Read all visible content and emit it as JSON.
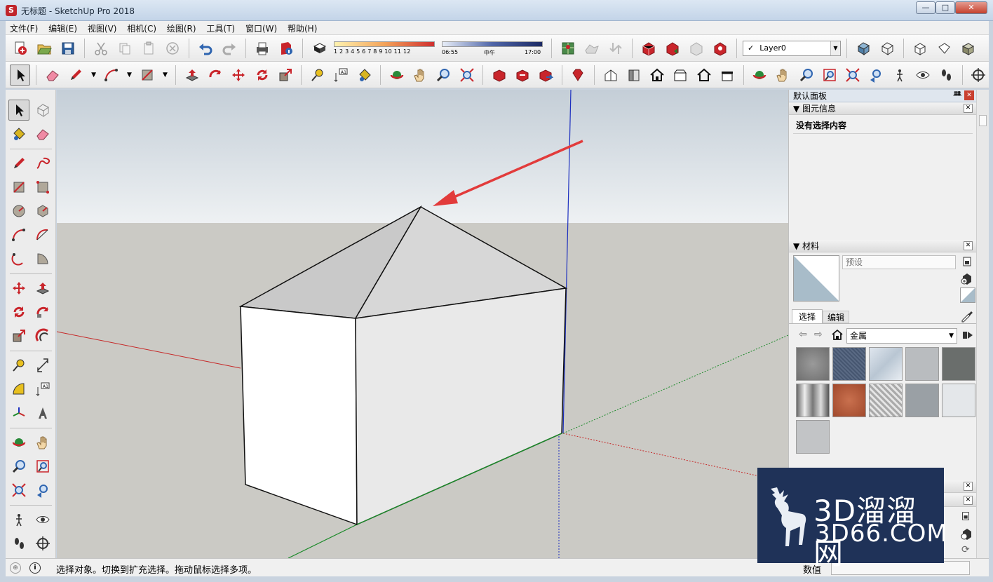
{
  "window": {
    "title": "无标题 - SketchUp Pro 2018",
    "minimize": "—",
    "maximize": "□",
    "close": "✕"
  },
  "menubar": [
    "文件(F)",
    "编辑(E)",
    "视图(V)",
    "相机(C)",
    "绘图(R)",
    "工具(T)",
    "窗口(W)",
    "帮助(H)"
  ],
  "toolbar": {
    "shadow_numbers": "1 2 3 4 5 6 7 8 9 10 11 12",
    "time_start": "06:55",
    "time_mid": "中午",
    "time_end": "17:00",
    "layer": "Layer0",
    "layer_check": "✓"
  },
  "default_tray": {
    "title": "默认面板",
    "pin": "ᚙ",
    "close": "✕"
  },
  "entity_info": {
    "title": "图元信息",
    "empty": "没有选择内容"
  },
  "materials": {
    "title": "材料",
    "name_placeholder": "预设",
    "tab_select": "选择",
    "tab_edit": "编辑",
    "collection": "金属"
  },
  "statusbar": {
    "hint": "选择对象。切换到扩充选择。拖动鼠标选择多项。",
    "measure_label": "数值"
  },
  "watermark": {
    "line1": "3D溜溜网",
    "line2": "3D66.COM"
  },
  "colors": {
    "sky_top": "#c5cfd8",
    "sky_bottom": "#eef2f4",
    "ground": "#cbcac5",
    "accent_red": "#e23b3b",
    "axis_blue": "#1c2fbf",
    "axis_green": "#1c8a2a",
    "axis_red": "#c62828"
  }
}
